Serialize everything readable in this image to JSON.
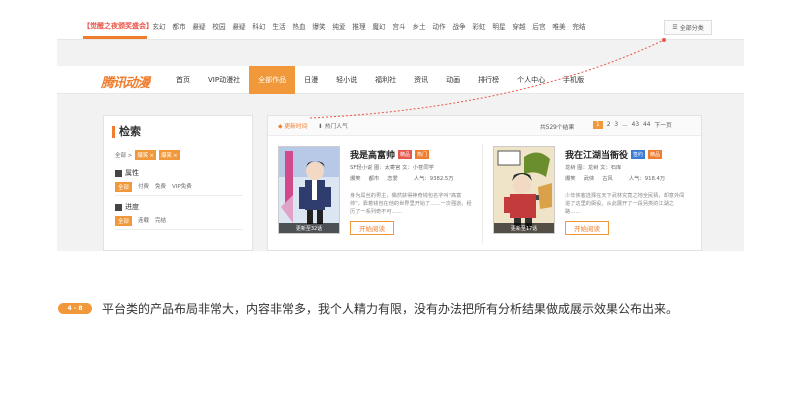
{
  "genre_bar": {
    "promo": "【觉醒之夜颁奖盛会】",
    "genres": [
      "玄幻",
      "都市",
      "悬疑",
      "校园",
      "悬疑",
      "科幻",
      "生活",
      "热血",
      "爆笑",
      "纯爱",
      "推理",
      "魔幻",
      "宫斗",
      "乡土",
      "动作",
      "战争",
      "彩虹",
      "明星",
      "穿越",
      "后宫",
      "唯美",
      "完结"
    ],
    "all_label": "全部分类"
  },
  "nav": {
    "logo": "腾讯动漫",
    "items": [
      "首页",
      "VIP动漫社",
      "全部作品",
      "日漫",
      "轻小说",
      "福利社",
      "资讯",
      "动画",
      "排行榜",
      "个人中心",
      "手机版"
    ],
    "active_index": 2
  },
  "search": {
    "title": "检索",
    "all_prefix": "全部 >",
    "chips": [
      "爆笑",
      "爆笑"
    ],
    "attr_title": "属性",
    "attr_options": [
      "全部",
      "付费",
      "免费",
      "VIP免费"
    ],
    "progress_title": "进度",
    "progress_options": [
      "全部",
      "连载",
      "完结"
    ]
  },
  "list": {
    "tab_latest": "更新时间",
    "tab_hot": "热门人气",
    "result": "共529个结果",
    "pages": [
      "1",
      "2",
      "3",
      "...",
      "43",
      "44",
      "下一页"
    ],
    "books": [
      {
        "title": "我是高富帅",
        "tags": [
          "精品",
          "热门"
        ],
        "meta1": "SF轻小说 图：太寄宫 文：小苍同学",
        "meta2_a": "爆笑",
        "meta2_b": "都市",
        "meta2_c": "恋爱",
        "meta2_d": "人气：9382.5万",
        "desc": "身为屌丝的男主，偶然获得神奇钱包名字叫\"高富帅\"，靠着钱包在他的世界里开始了……一次强逝。经历了一系列奇不可……",
        "update": "更新至32话",
        "read": "开始阅读"
      },
      {
        "title": "我在江湖当衙役",
        "tags": [
          "签约",
          "精品"
        ],
        "meta1": "龙树 图：龙树 文：石库",
        "meta2_a": "爆笑",
        "meta2_b": "武侠",
        "meta2_c": "古风",
        "meta2_d": "人气：918.4万",
        "desc": "少年侠客选择在天下武林究竟之地全民猜，却意外闯进了这里的衙役。从此展开了一段另类的江湖之路……",
        "update": "更新至17话",
        "read": "开始阅读"
      }
    ]
  },
  "caption": {
    "badge": "4 - 8",
    "text": "平台类的产品布局非常大，内容非常多，我个人精力有限，没有办法把所有分析结果做成展示效果公布出来。"
  },
  "colors": {
    "accent": "#f07c2d",
    "accent_light": "#f0983a",
    "tag_red": "#e8574b",
    "tag_blue": "#3a7bd5",
    "tag_green": "#6bb04a"
  }
}
